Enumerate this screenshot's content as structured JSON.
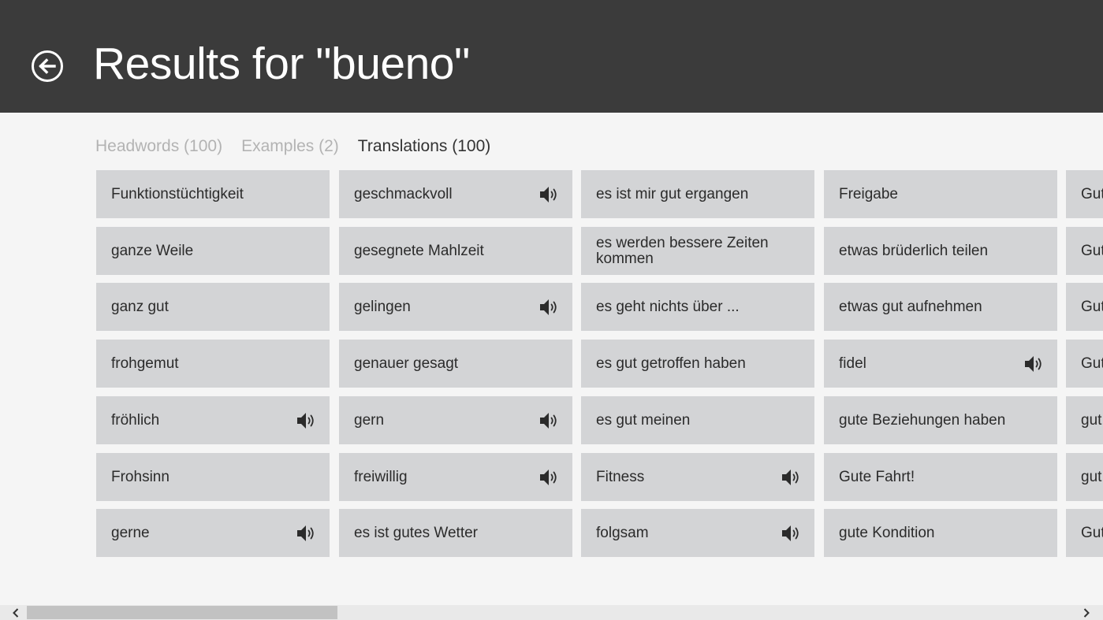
{
  "header": {
    "title": "Results for \"bueno\"",
    "background": "#3b3b3b"
  },
  "tabs": [
    {
      "label": "Headwords (100)",
      "active": false
    },
    {
      "label": "Examples (2)",
      "active": false
    },
    {
      "label": "Translations (100)",
      "active": true
    }
  ],
  "results": [
    [
      {
        "label": "Funktionstüchtigkeit",
        "audio": false
      },
      {
        "label": "ganze Weile",
        "audio": false
      },
      {
        "label": "ganz gut",
        "audio": false
      },
      {
        "label": "frohgemut",
        "audio": false
      },
      {
        "label": "fröhlich",
        "audio": true
      },
      {
        "label": "Frohsinn",
        "audio": false
      },
      {
        "label": "gerne",
        "audio": true
      }
    ],
    [
      {
        "label": "geschmackvoll",
        "audio": true
      },
      {
        "label": "gesegnete Mahlzeit",
        "audio": false
      },
      {
        "label": "gelingen",
        "audio": true
      },
      {
        "label": "genauer gesagt",
        "audio": false
      },
      {
        "label": "gern",
        "audio": true
      },
      {
        "label": "freiwillig",
        "audio": true
      },
      {
        "label": "es ist gutes Wetter",
        "audio": false
      }
    ],
    [
      {
        "label": "es ist mir gut ergangen",
        "audio": false
      },
      {
        "label": "es werden bessere Zeiten kommen",
        "audio": false
      },
      {
        "label": "es geht nichts über ...",
        "audio": false
      },
      {
        "label": "es gut getroffen haben",
        "audio": false
      },
      {
        "label": "es gut meinen",
        "audio": false
      },
      {
        "label": "Fitness",
        "audio": true
      },
      {
        "label": "folgsam",
        "audio": true
      }
    ],
    [
      {
        "label": "Freigabe",
        "audio": false
      },
      {
        "label": "etwas brüderlich teilen",
        "audio": false
      },
      {
        "label": "etwas gut aufnehmen",
        "audio": false
      },
      {
        "label": "fidel",
        "audio": true
      },
      {
        "label": "gute Beziehungen haben",
        "audio": false
      },
      {
        "label": "Gute Fahrt!",
        "audio": false
      },
      {
        "label": "gute Kondition",
        "audio": false
      }
    ],
    [
      {
        "label": "Gut",
        "audio": false
      },
      {
        "label": "Gut",
        "audio": false
      },
      {
        "label": "Gut",
        "audio": false
      },
      {
        "label": "Gut",
        "audio": false
      },
      {
        "label": "gut",
        "audio": false
      },
      {
        "label": "gut",
        "audio": false
      },
      {
        "label": "Gut",
        "audio": false
      }
    ]
  ],
  "icons": {
    "back": "back-arrow-icon",
    "audio": "speaker-icon",
    "scroll_left": "chevron-left-icon",
    "scroll_right": "chevron-right-icon"
  },
  "colors": {
    "tile": "#d3d4d6",
    "tab_inactive": "#b3b3b3",
    "tab_active": "#333333"
  },
  "scroll": {
    "position": 0.0
  }
}
